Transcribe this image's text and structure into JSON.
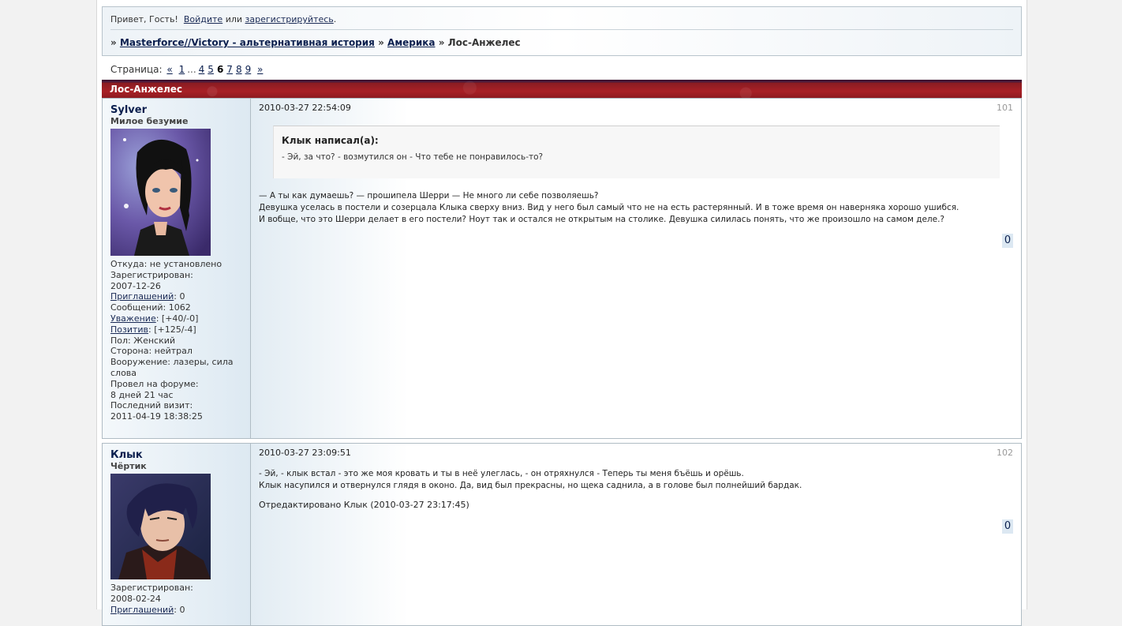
{
  "header": {
    "greeting": "Привет, Гость!",
    "login_link": "Войдите",
    "or_text": "или",
    "register_link": "зарегистрируйтесь",
    "period": "."
  },
  "breadcrumb": {
    "sep": "»",
    "items": [
      "Masterforce//Victory - альтернативная история",
      "Америка"
    ],
    "current": "Лос-Анжелес"
  },
  "pager": {
    "label": "Страница:",
    "prev": "«",
    "first": "1",
    "dots": "...",
    "pages": [
      "4",
      "5"
    ],
    "current": "6",
    "after": [
      "7",
      "8",
      "9"
    ],
    "next": "»"
  },
  "thread": {
    "title": "Лос-Анжелес"
  },
  "posts": [
    {
      "author": "Sylver",
      "author_title": "Милое безумие",
      "info": {
        "from": "Откуда: не установлено",
        "registered_label": "Зарегистрирован:",
        "registered": "2007-12-26",
        "invites_link": "Приглашений",
        "invites": ": 0",
        "messages": "Сообщений: 1062",
        "respect_link": "Уважение",
        "respect": ": [+40/-0]",
        "positive_link": "Позитив",
        "positive": ": [+125/-4]",
        "gender": "Пол: Женский",
        "side": "Сторона: нейтрал",
        "weapons_1": "Вооружение: лазеры, сила",
        "weapons_2": "слова",
        "time_label": "Провел на форуме:",
        "time": "8 дней 21 час",
        "last_label": "Последний визит:",
        "last": "2011-04-19 18:38:25"
      },
      "date": "2010-03-27 22:54:09",
      "number": "101",
      "quote_header": "Клык написал(а):",
      "quote_text": "- Эй, за что? - возмутился он - Что тебе не понравилось-то?",
      "lines": [
        "— А ты как думаешь? — прошипела Шерри — Не много ли себе позволяешь?",
        "Девушка уселась в постели и созерцала Клыка сверху вниз. Вид у него был самый что не на есть растерянный. И в тоже время он наверняка хорошо ушибся.",
        "И вобще, что это Шерри делает в его постели? Ноут так и остался не открытым на столике. Девушка силилась понять, что же произошло на самом деле.?"
      ],
      "rating": "0"
    },
    {
      "author": "Клык",
      "author_title": "Чёртик",
      "info": {
        "registered_label": "Зарегистрирован:",
        "registered": "2008-02-24",
        "invites_link": "Приглашений",
        "invites": ": 0"
      },
      "date": "2010-03-27 23:09:51",
      "number": "102",
      "lines": [
        "- Эй, - клык встал - это же моя кровать и ты в неё улеглась, - он отряхнулся - Теперь ты меня бъёшь и орёшь.",
        "Клык насупился и отвернулся глядя в оконо. Да, вид был прекрасны, но щека саднила, а в голове был полнейший бардак."
      ],
      "edited": "Отредактировано Клык (2010-03-27 23:17:45)",
      "rating": "0"
    }
  ]
}
